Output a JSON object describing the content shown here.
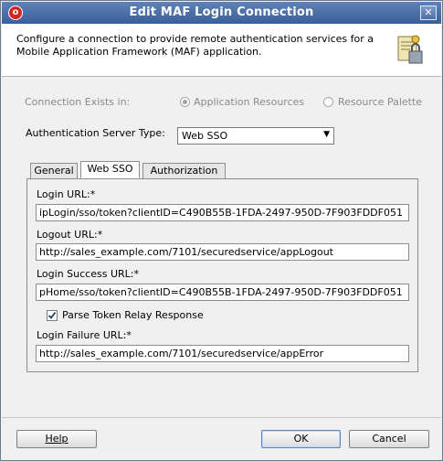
{
  "window": {
    "title": "Edit MAF Login Connection",
    "description": "Configure a connection to provide remote authentication services for a Mobile Application Framework (MAF) application."
  },
  "connection_exists": {
    "label": "Connection Exists in:",
    "options": [
      {
        "label": "Application Resources",
        "selected": true,
        "enabled": false
      },
      {
        "label": "Resource Palette",
        "selected": false,
        "enabled": false
      }
    ]
  },
  "auth_server_type": {
    "label": "Authentication Server Type:",
    "value": "Web SSO"
  },
  "tabs": [
    {
      "label": "General",
      "active": false
    },
    {
      "label": "Web SSO",
      "active": true
    },
    {
      "label": "Authorization",
      "active": false
    }
  ],
  "fields": {
    "login_url": {
      "label": "Login URL:*",
      "value": "ipLogin/sso/token?clientID=C490B55B-1FDA-2497-950D-7F903FDDF051"
    },
    "logout_url": {
      "label": "Logout URL:*",
      "value": "http://sales_example.com/7101/securedservice/appLogout"
    },
    "login_success_url": {
      "label": "Login Success URL:*",
      "value": "pHome/sso/token?clientID=C490B55B-1FDA-2497-950D-7F903FDDF051"
    },
    "parse_token": {
      "label": "Parse Token Relay Response",
      "checked": true
    },
    "login_failure_url": {
      "label": "Login Failure URL:*",
      "value": "http://sales_example.com/7101/securedservice/appError"
    }
  },
  "buttons": {
    "help": "Help",
    "ok": "OK",
    "cancel": "Cancel"
  },
  "colors": {
    "title_bar": "#4a6ea8",
    "panel": "#f0f0f0",
    "disabled_text": "#8a8a8a"
  }
}
